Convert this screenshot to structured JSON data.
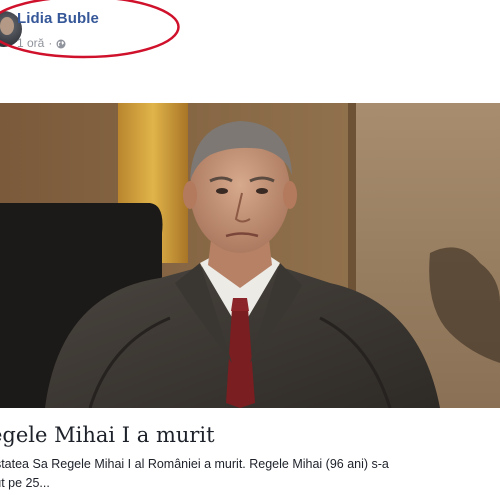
{
  "post": {
    "author_name": "Lidia Buble",
    "time": "1 oră",
    "separator": "·",
    "privacy_icon": "globe-icon"
  },
  "link": {
    "title": "egele Mihai I a murit",
    "description_line1": "estatea Sa Regele Mihai I al României a murit. Regele Mihai (96 ani) s-a",
    "description_line2": "cut pe 25..."
  },
  "colors": {
    "name_link": "#365899",
    "meta_text": "#90949c",
    "annotation_ellipse": "#d0112b"
  }
}
